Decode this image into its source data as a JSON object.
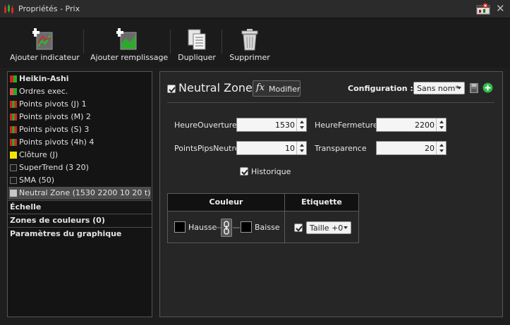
{
  "window": {
    "title": "Propriétés - Prix"
  },
  "toolbar": {
    "add_indicator": "Ajouter indicateur",
    "add_fill": "Ajouter remplissage",
    "duplicate": "Dupliquer",
    "delete": "Supprimer"
  },
  "list": {
    "items": [
      {
        "label": "Heikin-Ashi",
        "colors": [
          "#d22222",
          "#22b022"
        ]
      },
      {
        "label": "Ordres exec.",
        "colors": [
          "#e05050",
          "#2aa82a"
        ]
      },
      {
        "label": "Points pivots (J) 1",
        "colors": [
          "#d22222",
          "#22b022"
        ]
      },
      {
        "label": "Points pivots (M) 2",
        "colors": [
          "#d22222",
          "#22b022"
        ]
      },
      {
        "label": "Points pivots (S) 3",
        "colors": [
          "#d22222",
          "#22b022"
        ]
      },
      {
        "label": "Points pivots (4h) 4",
        "colors": [
          "#d22222",
          "#22b022"
        ]
      },
      {
        "label": "Clôture (J)",
        "colors": [
          "#f2e600"
        ]
      },
      {
        "label": "SuperTrend (3 20)",
        "colors": [
          "#1a1a1a"
        ]
      },
      {
        "label": "SMA (50)",
        "colors": [
          "#1a1a1a"
        ]
      },
      {
        "label": "Neutral Zone (1530 2200 10 20 t)",
        "colors": [
          "#c8c8c8"
        ]
      }
    ],
    "sections": [
      "Échelle",
      "Zones de couleurs (0)",
      "Paramètres du graphique"
    ]
  },
  "panel": {
    "title": "Neutral Zone",
    "modify_label": "Modifier",
    "config_label": "Configuration :",
    "config_value": "Sans nom*",
    "params": {
      "heure_ouverture_label": "HeureOuverture",
      "heure_ouverture_value": "1530",
      "heure_fermeture_label": "HeureFermeture",
      "heure_fermeture_value": "2200",
      "points_pips_label": "PointsPipsNeutre",
      "points_pips_value": "10",
      "transparence_label": "Transparence",
      "transparence_value": "20"
    },
    "historique_label": "Historique",
    "table": {
      "col_couleur": "Couleur",
      "col_etiquette": "Etiquette",
      "hausse_label": "Hausse",
      "baisse_label": "Baisse",
      "hausse_color": "#000000",
      "baisse_color": "#000000",
      "taille_value": "Taille +0"
    }
  }
}
